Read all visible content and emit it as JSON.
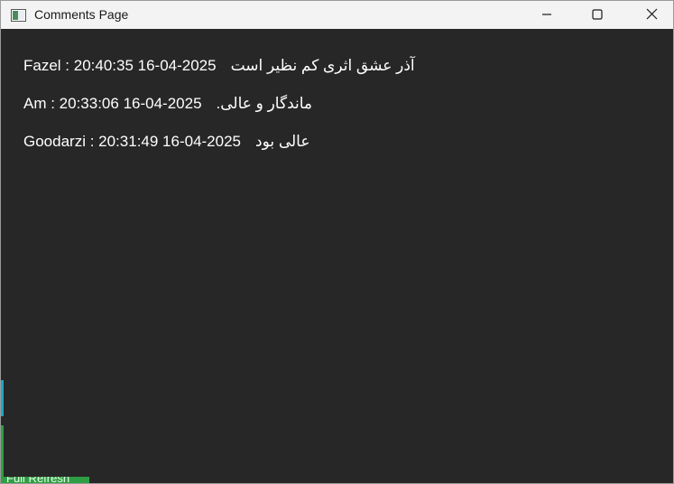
{
  "window": {
    "title": "Comments Page",
    "icon": "app-window-icon",
    "controls": {
      "minimize": "minimize-icon",
      "maximize": "maximize-icon",
      "close": "close-icon"
    }
  },
  "comments": [
    {
      "meta": "Fazel : 20:40:35 16-04-2025",
      "text": "آذر عشق اثری کم نظیر است"
    },
    {
      "meta": "Am : 20:33:06 16-04-2025",
      "text": "ماندگار و عالی."
    },
    {
      "meta": "Goodarzi : 20:31:49 16-04-2025",
      "text": "عالی بود"
    }
  ],
  "background_peek": {
    "label": "Full Refresh"
  },
  "colors": {
    "background": "#272727",
    "text": "#ffffff",
    "titlebar": "#f3f3f3"
  }
}
